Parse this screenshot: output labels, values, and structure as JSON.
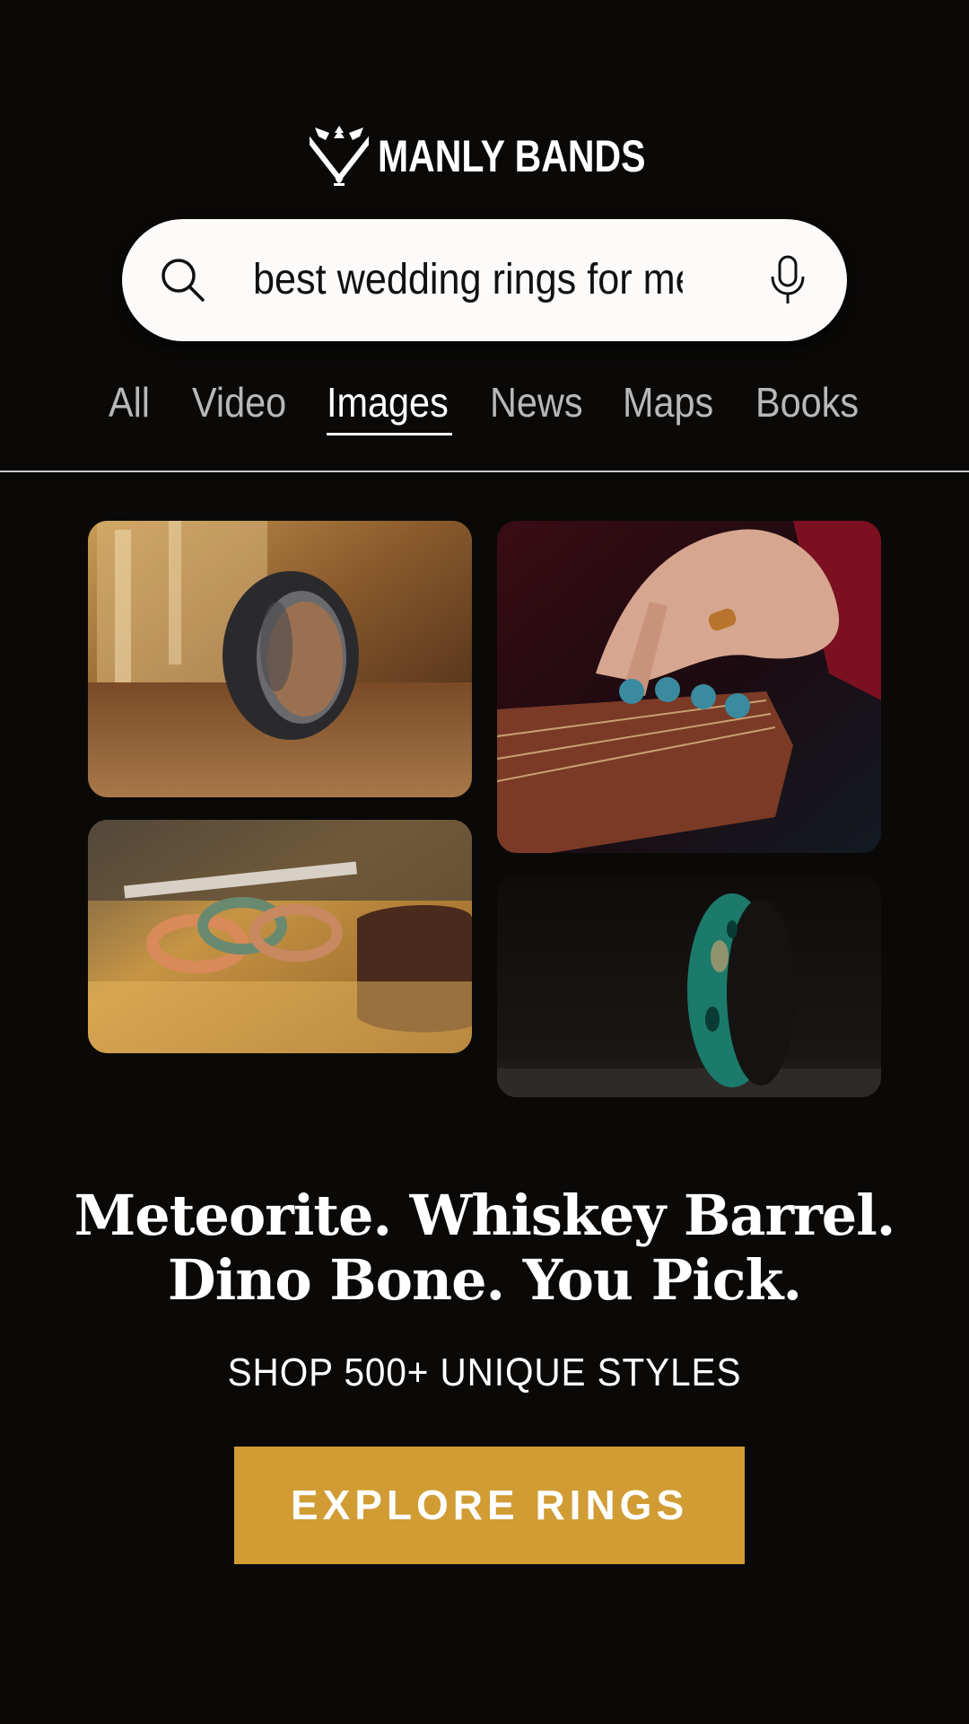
{
  "brand": {
    "name": "MANLY BANDS",
    "logo_icon": "crossed-axes-icon"
  },
  "search": {
    "query": "best wedding rings for men",
    "search_icon": "search-icon",
    "mic_icon": "microphone-icon"
  },
  "tabs": [
    {
      "label": "All",
      "active": false
    },
    {
      "label": "Video",
      "active": false
    },
    {
      "label": "Images",
      "active": true
    },
    {
      "label": "News",
      "active": false
    },
    {
      "label": "Maps",
      "active": false
    },
    {
      "label": "Books",
      "active": false
    }
  ],
  "images": [
    {
      "subject": "hammered black ring on wooden table with whiskey glass"
    },
    {
      "subject": "hand with wooden ring tuning guitar headstock"
    },
    {
      "subject": "three rose gold rings on golden surface"
    },
    {
      "subject": "turquoise and black ring on dark background"
    }
  ],
  "headline": {
    "line1": "Meteorite. Whiskey Barrel.",
    "line2": "Dino Bone. You Pick."
  },
  "subhead": "SHOP 500+ UNIQUE STYLES",
  "cta": {
    "label": "EXPLORE RINGS"
  },
  "colors": {
    "background": "#0a0908",
    "cta": "#d09c33",
    "search_bg": "#fdfafa",
    "tab_inactive": "#b8b8b8",
    "tab_active": "#ffffff"
  }
}
